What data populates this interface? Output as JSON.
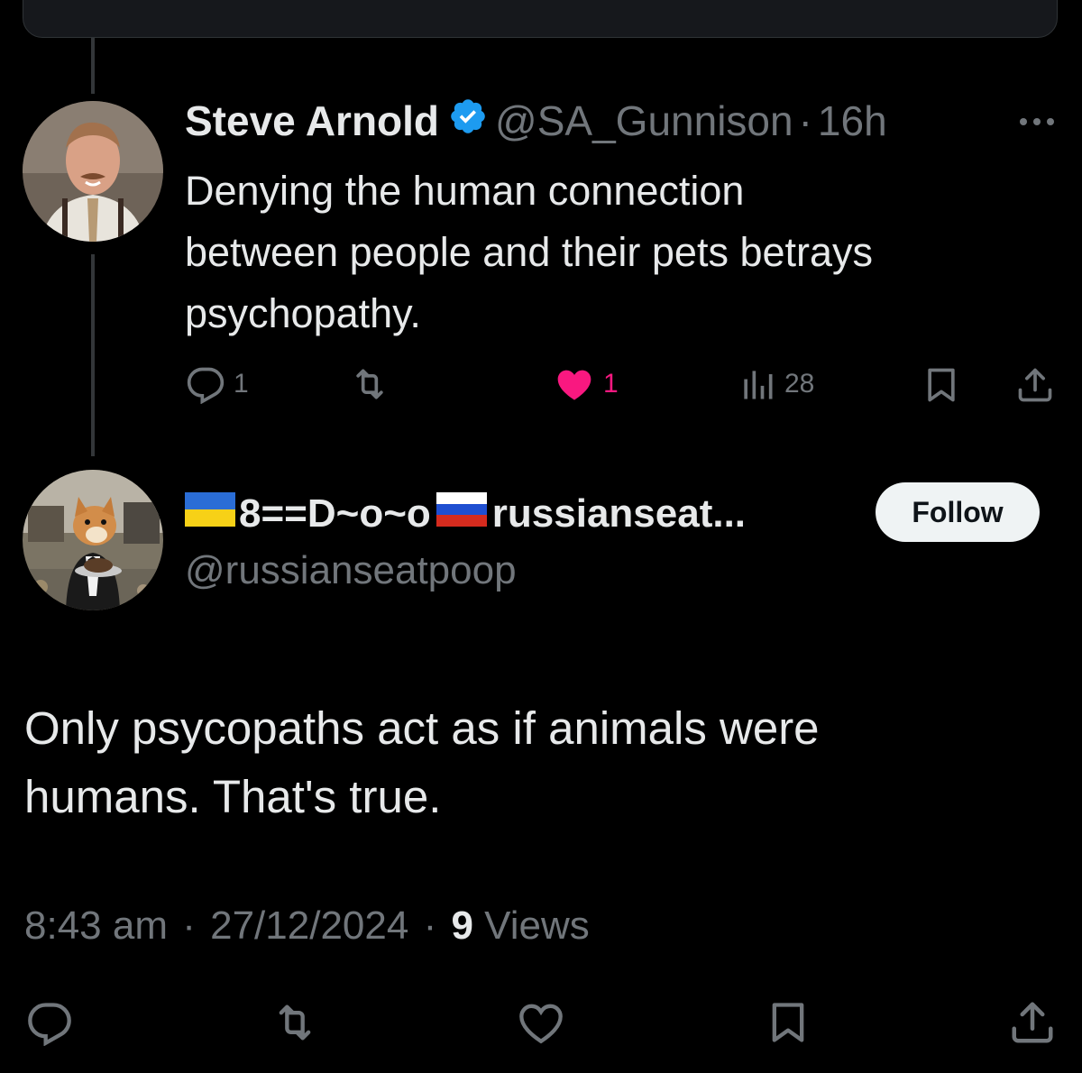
{
  "parent_tweet": {
    "author_name": "Steve Arnold",
    "handle": "@SA_Gunnison",
    "separator": "·",
    "time": "16h",
    "text": "Denying the human connection\nbetween people and their pets betrays\npsychopathy.",
    "replies": "1",
    "retweets": "",
    "likes": "1",
    "views": "28",
    "like_color": "#f91880"
  },
  "main_tweet": {
    "author_name_text": "8==D~o~o",
    "author_name_suffix": "russianseat...",
    "handle": "@russianseatpoop",
    "follow_label": "Follow",
    "text": "Only psycopaths act as if animals were\nhumans. That's true.",
    "time": "8:43 am",
    "dot1": "·",
    "date": "27/12/2024",
    "dot2": "·",
    "views_count": "9",
    "views_label": "Views"
  },
  "colors": {
    "background": "#000000",
    "text": "#e7e9ea",
    "muted": "#71767b",
    "verified": "#1d9bf0",
    "like": "#f91880"
  },
  "icons": [
    "reply-icon",
    "retweet-icon",
    "like-icon",
    "views-icon",
    "bookmark-icon",
    "share-icon",
    "verified-icon",
    "more-icon"
  ]
}
